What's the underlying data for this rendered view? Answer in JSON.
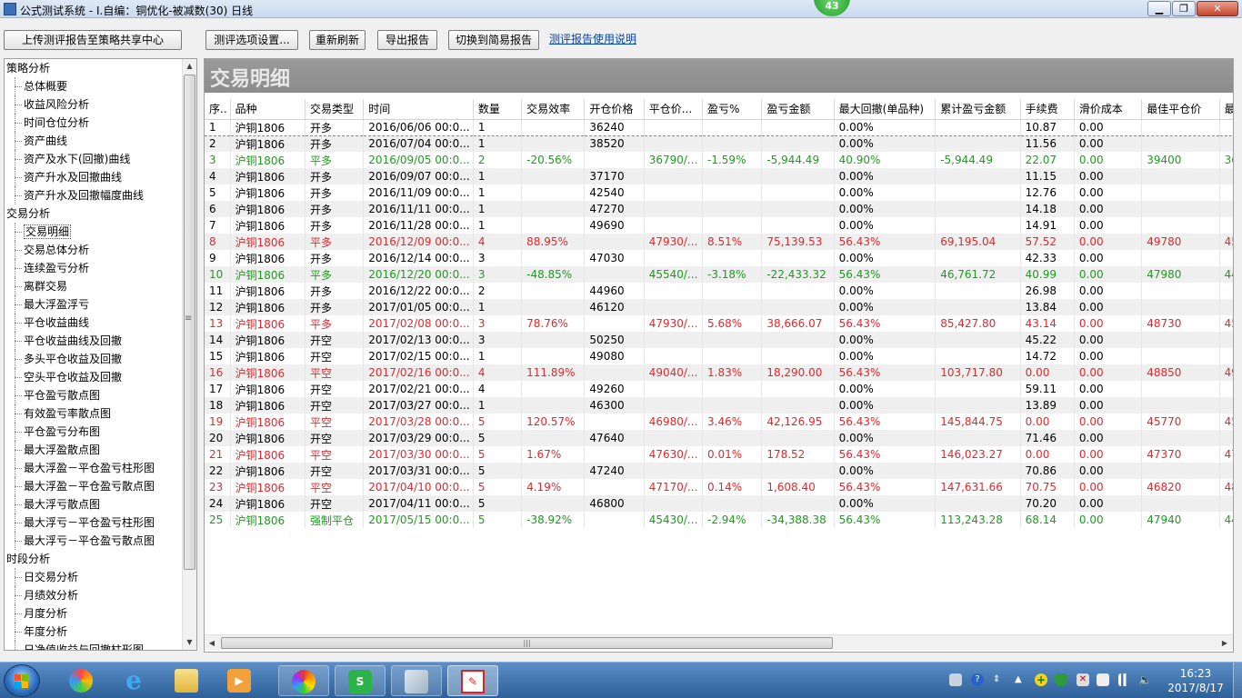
{
  "window": {
    "title": "公式测试系统 - I.自编：铜优化-被减数(30) 日线",
    "badge": "43"
  },
  "toolbar": {
    "upload": "上传测评报告至策略共享中心",
    "settings": "测评选项设置...",
    "refresh": "重新刷新",
    "export": "导出报告",
    "simple": "切换到简易报告",
    "help": "测评报告使用说明"
  },
  "tree": {
    "items": [
      {
        "label": "策略分析",
        "cat": true
      },
      {
        "label": "总体概要"
      },
      {
        "label": "收益风险分析"
      },
      {
        "label": "时间仓位分析"
      },
      {
        "label": "资产曲线"
      },
      {
        "label": "资产及水下(回撤)曲线"
      },
      {
        "label": "资产升水及回撤曲线"
      },
      {
        "label": "资产升水及回撤幅度曲线"
      },
      {
        "label": "交易分析",
        "cat": true
      },
      {
        "label": "交易明细",
        "selected": true
      },
      {
        "label": "交易总体分析"
      },
      {
        "label": "连续盈亏分析"
      },
      {
        "label": "离群交易"
      },
      {
        "label": "最大浮盈浮亏"
      },
      {
        "label": "平仓收益曲线"
      },
      {
        "label": "平仓收益曲线及回撤"
      },
      {
        "label": "多头平仓收益及回撤"
      },
      {
        "label": "空头平仓收益及回撤"
      },
      {
        "label": "平仓盈亏散点图"
      },
      {
        "label": "有效盈亏率散点图"
      },
      {
        "label": "平仓盈亏分布图"
      },
      {
        "label": "最大浮盈散点图"
      },
      {
        "label": "最大浮盈－平仓盈亏柱形图"
      },
      {
        "label": "最大浮盈－平仓盈亏散点图"
      },
      {
        "label": "最大浮亏散点图"
      },
      {
        "label": "最大浮亏－平仓盈亏柱形图"
      },
      {
        "label": "最大浮亏－平仓盈亏散点图"
      },
      {
        "label": "时段分析",
        "cat": true
      },
      {
        "label": "日交易分析"
      },
      {
        "label": "月绩效分析"
      },
      {
        "label": "月度分析"
      },
      {
        "label": "年度分析"
      },
      {
        "label": "日净值收益与回撤柱形图"
      }
    ]
  },
  "main": {
    "title": "交易明细",
    "columns": [
      "序..",
      "品种",
      "交易类型",
      "时间",
      "数量",
      "交易效率",
      "开仓价格",
      "平仓价...",
      "盈亏%",
      "盈亏金额",
      "最大回撤(单品种)",
      "累计盈亏金额",
      "手续费",
      "滑价成本",
      "最佳平仓价",
      "最"
    ],
    "rows": [
      {
        "style": "",
        "cells": [
          "1",
          "沪铜1806",
          "开多",
          "2016/06/06 00:0...",
          "1",
          "",
          "36240",
          "",
          "",
          "",
          "0.00%",
          "",
          "10.87",
          "0.00",
          "",
          ""
        ]
      },
      {
        "style": "",
        "cells": [
          "2",
          "沪铜1806",
          "开多",
          "2016/07/04 00:0...",
          "1",
          "",
          "38520",
          "",
          "",
          "",
          "0.00%",
          "",
          "11.56",
          "0.00",
          "",
          ""
        ]
      },
      {
        "style": "green",
        "cells": [
          "3",
          "沪铜1806",
          "平多",
          "2016/09/05 00:0...",
          "2",
          "-20.56%",
          "",
          "36790/...",
          "-1.59%",
          "-5,944.49",
          "40.90%",
          "-5,944.49",
          "22.07",
          "0.00",
          "39400",
          "36"
        ]
      },
      {
        "style": "",
        "cells": [
          "4",
          "沪铜1806",
          "开多",
          "2016/09/07 00:0...",
          "1",
          "",
          "37170",
          "",
          "",
          "",
          "0.00%",
          "",
          "11.15",
          "0.00",
          "",
          ""
        ]
      },
      {
        "style": "",
        "cells": [
          "5",
          "沪铜1806",
          "开多",
          "2016/11/09 00:0...",
          "1",
          "",
          "42540",
          "",
          "",
          "",
          "0.00%",
          "",
          "12.76",
          "0.00",
          "",
          ""
        ]
      },
      {
        "style": "",
        "cells": [
          "6",
          "沪铜1806",
          "开多",
          "2016/11/11 00:0...",
          "1",
          "",
          "47270",
          "",
          "",
          "",
          "0.00%",
          "",
          "14.18",
          "0.00",
          "",
          ""
        ]
      },
      {
        "style": "",
        "cells": [
          "7",
          "沪铜1806",
          "开多",
          "2016/11/28 00:0...",
          "1",
          "",
          "49690",
          "",
          "",
          "",
          "0.00%",
          "",
          "14.91",
          "0.00",
          "",
          ""
        ]
      },
      {
        "style": "red",
        "cells": [
          "8",
          "沪铜1806",
          "平多",
          "2016/12/09 00:0...",
          "4",
          "88.95%",
          "",
          "47930/...",
          "8.51%",
          "75,139.53",
          "56.43%",
          "69,195.04",
          "57.52",
          "0.00",
          "49780",
          "45"
        ]
      },
      {
        "style": "",
        "cells": [
          "9",
          "沪铜1806",
          "开多",
          "2016/12/14 00:0...",
          "3",
          "",
          "47030",
          "",
          "",
          "",
          "0.00%",
          "",
          "42.33",
          "0.00",
          "",
          ""
        ]
      },
      {
        "style": "green",
        "cells": [
          "10",
          "沪铜1806",
          "平多",
          "2016/12/20 00:0...",
          "3",
          "-48.85%",
          "",
          "45540/...",
          "-3.18%",
          "-22,433.32",
          "56.43%",
          "46,761.72",
          "40.99",
          "0.00",
          "47980",
          "44"
        ]
      },
      {
        "style": "",
        "cells": [
          "11",
          "沪铜1806",
          "开多",
          "2016/12/22 00:0...",
          "2",
          "",
          "44960",
          "",
          "",
          "",
          "0.00%",
          "",
          "26.98",
          "0.00",
          "",
          ""
        ]
      },
      {
        "style": "",
        "cells": [
          "12",
          "沪铜1806",
          "开多",
          "2017/01/05 00:0...",
          "1",
          "",
          "46120",
          "",
          "",
          "",
          "0.00%",
          "",
          "13.84",
          "0.00",
          "",
          ""
        ]
      },
      {
        "style": "red",
        "cells": [
          "13",
          "沪铜1806",
          "平多",
          "2017/02/08 00:0...",
          "3",
          "78.76%",
          "",
          "47930/...",
          "5.68%",
          "38,666.07",
          "56.43%",
          "85,427.80",
          "43.14",
          "0.00",
          "48730",
          "45"
        ]
      },
      {
        "style": "",
        "cells": [
          "14",
          "沪铜1806",
          "开空",
          "2017/02/13 00:0...",
          "3",
          "",
          "50250",
          "",
          "",
          "",
          "0.00%",
          "",
          "45.22",
          "0.00",
          "",
          ""
        ]
      },
      {
        "style": "",
        "cells": [
          "15",
          "沪铜1806",
          "开空",
          "2017/02/15 00:0...",
          "1",
          "",
          "49080",
          "",
          "",
          "",
          "0.00%",
          "",
          "14.72",
          "0.00",
          "",
          ""
        ]
      },
      {
        "style": "red",
        "cells": [
          "16",
          "沪铜1806",
          "平空",
          "2017/02/16 00:0...",
          "4",
          "111.89%",
          "",
          "49040/...",
          "1.83%",
          "18,290.00",
          "56.43%",
          "103,717.80",
          "0.00",
          "0.00",
          "48850",
          "49"
        ]
      },
      {
        "style": "",
        "cells": [
          "17",
          "沪铜1806",
          "开空",
          "2017/02/21 00:0...",
          "4",
          "",
          "49260",
          "",
          "",
          "",
          "0.00%",
          "",
          "59.11",
          "0.00",
          "",
          ""
        ]
      },
      {
        "style": "",
        "cells": [
          "18",
          "沪铜1806",
          "开空",
          "2017/03/27 00:0...",
          "1",
          "",
          "46300",
          "",
          "",
          "",
          "0.00%",
          "",
          "13.89",
          "0.00",
          "",
          ""
        ]
      },
      {
        "style": "red",
        "cells": [
          "19",
          "沪铜1806",
          "平空",
          "2017/03/28 00:0...",
          "5",
          "120.57%",
          "",
          "46980/...",
          "3.46%",
          "42,126.95",
          "56.43%",
          "145,844.75",
          "0.00",
          "0.00",
          "45770",
          "45"
        ]
      },
      {
        "style": "",
        "cells": [
          "20",
          "沪铜1806",
          "开空",
          "2017/03/29 00:0...",
          "5",
          "",
          "47640",
          "",
          "",
          "",
          "0.00%",
          "",
          "71.46",
          "0.00",
          "",
          ""
        ]
      },
      {
        "style": "red",
        "cells": [
          "21",
          "沪铜1806",
          "平空",
          "2017/03/30 00:0...",
          "5",
          "1.67%",
          "",
          "47630/...",
          "0.01%",
          "178.52",
          "56.43%",
          "146,023.27",
          "0.00",
          "0.00",
          "47370",
          "47"
        ]
      },
      {
        "style": "",
        "cells": [
          "22",
          "沪铜1806",
          "开空",
          "2017/03/31 00:0...",
          "5",
          "",
          "47240",
          "",
          "",
          "",
          "0.00%",
          "",
          "70.86",
          "0.00",
          "",
          ""
        ]
      },
      {
        "style": "red",
        "cells": [
          "23",
          "沪铜1806",
          "平空",
          "2017/04/10 00:0...",
          "5",
          "4.19%",
          "",
          "47170/...",
          "0.14%",
          "1,608.40",
          "56.43%",
          "147,631.66",
          "70.75",
          "0.00",
          "46820",
          "48"
        ]
      },
      {
        "style": "",
        "cells": [
          "24",
          "沪铜1806",
          "开空",
          "2017/04/11 00:0...",
          "5",
          "",
          "46800",
          "",
          "",
          "",
          "0.00%",
          "",
          "70.20",
          "0.00",
          "",
          ""
        ]
      },
      {
        "style": "green",
        "cells": [
          "25",
          "沪铜1806",
          "强制平仓",
          "2017/05/15 00:0...",
          "5",
          "-38.92%",
          "",
          "45430/...",
          "-2.94%",
          "-34,388.38",
          "56.43%",
          "113,243.28",
          "68.14",
          "0.00",
          "47940",
          "44"
        ]
      }
    ]
  },
  "taskbar": {
    "time": "16:23",
    "date": "2017/8/17"
  }
}
